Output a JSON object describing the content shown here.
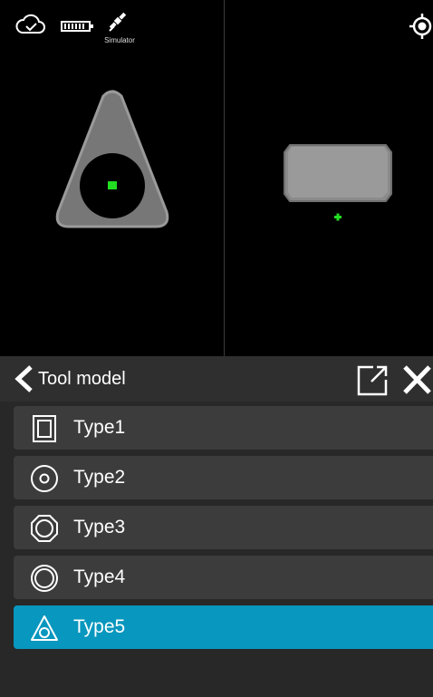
{
  "status": {
    "cloud_icon": "cloud-check-icon",
    "battery_icon": "battery-icon",
    "satellite_icon": "satellite-icon",
    "satellite_label": "Simulator",
    "locate_icon": "target-locate-icon"
  },
  "panel": {
    "title": "Tool model",
    "back_icon": "chevron-left-icon",
    "popout_icon": "external-window-icon",
    "close_icon": "close-icon"
  },
  "tool_models": [
    {
      "label": "Type1",
      "icon": "square-frame-icon",
      "selected": false
    },
    {
      "label": "Type2",
      "icon": "circle-ring-icon",
      "selected": false
    },
    {
      "label": "Type3",
      "icon": "octagon-ring-icon",
      "selected": false
    },
    {
      "label": "Type4",
      "icon": "double-circle-icon",
      "selected": false
    },
    {
      "label": "Type5",
      "icon": "triangle-ring-icon",
      "selected": true
    }
  ],
  "colors": {
    "accent": "#0897be",
    "marker": "#22dd22",
    "item_bg": "#3c3c3c",
    "panel_bg": "#282828"
  }
}
